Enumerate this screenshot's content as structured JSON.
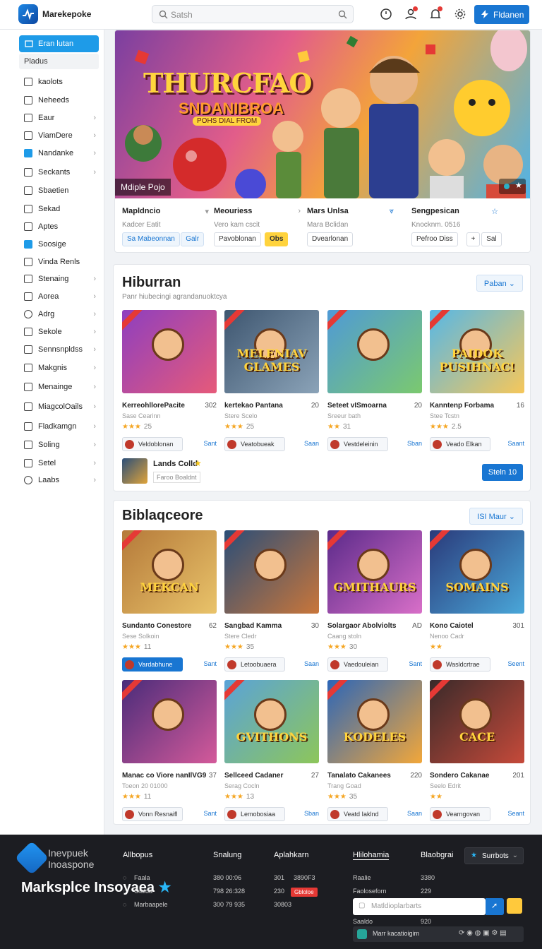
{
  "header": {
    "brand": "Marekepoke",
    "search_placeholder": "Satsh",
    "cta_label": "Fldanen"
  },
  "sidebar": {
    "active": "Eran lutan",
    "section": "Pladus",
    "items": [
      {
        "label": "kaolots",
        "chevron": false,
        "icon": "home-icon"
      },
      {
        "label": "Neheeds",
        "chevron": false,
        "icon": "bag-icon"
      },
      {
        "label": "Eaur",
        "chevron": true,
        "icon": "pen-icon"
      },
      {
        "label": "ViamDere",
        "chevron": true,
        "icon": "doc-icon"
      },
      {
        "label": "Nandanke",
        "chevron": true,
        "icon": "square-icon"
      },
      {
        "label": "Seckants",
        "chevron": true,
        "icon": "list-icon"
      },
      {
        "label": "Sbaetien",
        "chevron": false,
        "icon": "box-icon"
      },
      {
        "label": "Sekad",
        "chevron": false,
        "icon": "grid-icon"
      },
      {
        "label": "Aptes",
        "chevron": false,
        "icon": "app-icon"
      },
      {
        "label": "Soosige",
        "chevron": false,
        "icon": "shield-icon"
      },
      {
        "label": "Vinda Renls",
        "chevron": false,
        "icon": "cart-icon"
      },
      {
        "label": "Stenaing",
        "chevron": true,
        "icon": "menu-icon"
      },
      {
        "label": "Aorea",
        "chevron": true,
        "icon": "tag-icon"
      },
      {
        "label": "Adrg",
        "chevron": true,
        "icon": "circle-icon"
      },
      {
        "label": "Sekole",
        "chevron": true,
        "icon": "chart-icon"
      },
      {
        "label": "Sennsnpldss",
        "chevron": true,
        "icon": "table-icon"
      },
      {
        "label": "Makgnis",
        "chevron": true,
        "icon": "cal-icon"
      },
      {
        "label": "Menainge",
        "chevron": true,
        "icon": "mail-icon"
      },
      {
        "label": "MiagcolOails",
        "chevron": true,
        "icon": "image-icon"
      },
      {
        "label": "Fladkamgn",
        "chevron": true,
        "icon": "folder-icon"
      },
      {
        "label": "Soling",
        "chevron": true,
        "icon": "bars-icon"
      },
      {
        "label": "Setel",
        "chevron": true,
        "icon": "checkbox-icon"
      },
      {
        "label": "Laabs",
        "chevron": true,
        "icon": "gear-icon"
      }
    ]
  },
  "hero": {
    "title": "THURCFAO",
    "subtitle": "SNDANIBROA",
    "tagline": "POHS DIAL FROM",
    "chip": "Mdiple Pojo",
    "cards": [
      {
        "title": "Mapldncio",
        "sub": "Kadcer Eatit",
        "pills": [
          "Sa Mabeonnan",
          "Galr"
        ]
      },
      {
        "title": "Meouriess",
        "sub": "Vero kam cscit",
        "pills": [
          "Pavoblonan",
          "Obs"
        ]
      },
      {
        "title": "Mars Unlsa",
        "sub": "Mara Bclidan",
        "pills": [
          "Dvearlonan"
        ]
      },
      {
        "title": "Sengpesican",
        "sub": "Knocknm. 0516",
        "pills": [
          "Pefroo Diss",
          "+",
          "Sal"
        ]
      }
    ]
  },
  "section1": {
    "title": "Hiburran",
    "subtitle": "Panr hiubecingi agrandanuoktcya",
    "button": "Paban",
    "games": [
      {
        "name": "KerreohllorePacite",
        "price": "302",
        "sub": "Sase Cearinn",
        "stars": "★★★",
        "rating": "25",
        "pub": "Veldoblonan",
        "link": "Sant",
        "thumb": "",
        "c1": "#8e3fbf",
        "c2": "#e65a7a"
      },
      {
        "name": "kertekao Pantana",
        "price": "20",
        "sub": "Stere Scelo",
        "stars": "★★★",
        "rating": "25",
        "pub": "Veatobueak",
        "link": "Saan",
        "thumb": "MELENIAV GLAMES",
        "c1": "#3e5670",
        "c2": "#8ba3b8"
      },
      {
        "name": "Seteet vISmoarna",
        "price": "20",
        "sub": "Sreeur bath",
        "stars": "★★",
        "rating": "31",
        "pub": "Vestdeleinin",
        "link": "Sban",
        "thumb": "",
        "c1": "#4f9ad6",
        "c2": "#7bc96f"
      },
      {
        "name": "Kanntenp Forbama",
        "price": "16",
        "sub": "Stee Tcstn",
        "stars": "★★★",
        "rating": "2.5",
        "pub": "Veado Elkan",
        "link": "Saant",
        "thumb": "PAIDOK PUSIHNAC!",
        "c1": "#57b7e6",
        "c2": "#f6c75a"
      }
    ],
    "featured": {
      "name": "Lands Colld",
      "sub": "Faroo Boaldnt",
      "button": "Steln 10"
    }
  },
  "section2": {
    "title": "Biblaqceore",
    "button": "ISI Maur",
    "games": [
      {
        "name": "Sundanto Conestore",
        "price": "62",
        "sub": "Sese Solkoin",
        "stars": "★★★",
        "rating": "11",
        "pub": "Vardabhune",
        "link": "Sant",
        "active": true,
        "thumb": "MEKCAN",
        "c1": "#b57a3a",
        "c2": "#e9c36a"
      },
      {
        "name": "Sangbad Kamma",
        "price": "30",
        "sub": "Stere Cledr",
        "stars": "★★★",
        "rating": "35",
        "pub": "Letoobuaera",
        "link": "Saan",
        "active": false,
        "thumb": "",
        "c1": "#2b4e78",
        "c2": "#c9763a"
      },
      {
        "name": "Solargaor Abolviolts",
        "price": "AD",
        "sub": "Caang stoln",
        "stars": "★★★",
        "rating": "30",
        "pub": "Vaedouleian",
        "link": "Sant",
        "active": false,
        "thumb": "GMITHAURS",
        "c1": "#5b2a8a",
        "c2": "#d86fc8"
      },
      {
        "name": "Kono Caiotel",
        "price": "301",
        "sub": "Nenoo Cadr",
        "stars": "★★",
        "rating": "",
        "pub": "Wasldcrtrae",
        "link": "Seent",
        "active": false,
        "thumb": "SOMAINS",
        "c1": "#2a3a7a",
        "c2": "#4aa7d9"
      },
      {
        "name": "Manac co Viore nanIlVG9",
        "price": "37",
        "sub": "Toeon 20 01000",
        "stars": "★★★",
        "rating": "11",
        "pub": "Vonn Resnaifl",
        "link": "Sant",
        "active": false,
        "thumb": "",
        "c1": "#4a2c7a",
        "c2": "#d45a9a"
      },
      {
        "name": "Sellceed Cadaner",
        "price": "27",
        "sub": "Serag Cocln",
        "stars": "★★★",
        "rating": "13",
        "pub": "Lemobosiaa",
        "link": "Sban",
        "active": false,
        "thumb": "GVITHONS",
        "c1": "#5aa3d8",
        "c2": "#8dc65a"
      },
      {
        "name": "Tanalato Cakanees",
        "price": "220",
        "sub": "Trang Goad",
        "stars": "★★★",
        "rating": "35",
        "pub": "Veatd Iaklnd",
        "link": "Saan",
        "active": false,
        "thumb": "KODELES",
        "c1": "#2c66b8",
        "c2": "#f2a73a"
      },
      {
        "name": "Sondero Cakanae",
        "price": "201",
        "sub": "Seelo Edrit",
        "stars": "★★",
        "rating": "",
        "pub": "Vearngovan",
        "link": "Seant",
        "active": false,
        "thumb": "CACE",
        "c1": "#3a2a2a",
        "c2": "#c64a3a"
      }
    ]
  },
  "footer": {
    "brand": "Inevpuek Inoaspone",
    "headline": "Marksplce Insoyaea",
    "cols": [
      "Allbopus",
      "Snalung",
      "Aplahkarn",
      "Hlilohamia",
      "Blaobgrai"
    ],
    "rows": [
      {
        "k": "Faala",
        "v1": "380 00:06",
        "v2": "301",
        "v3": "3890F3"
      },
      {
        "k": "Gialda",
        "v1": "798 26:328",
        "v2": "230",
        "v3": "Gbloloe"
      },
      {
        "k": "Marbaapele",
        "v1": "300 79 935",
        "v2": "30803"
      }
    ],
    "right": [
      {
        "k": "Raalie",
        "v": "3380"
      },
      {
        "k": "Faoloseforn",
        "v": "229"
      },
      {
        "k": "Saaldo",
        "v": "920"
      }
    ],
    "select": "Surrbots",
    "search_placeholder": "Matldioplarbarts",
    "bar": "Marr kacatioigim"
  },
  "colors": {
    "accent": "#1976d2",
    "sidebar_active": "#1e9be8",
    "star": "#f5a623",
    "footer_bg": "#1c1d22"
  }
}
